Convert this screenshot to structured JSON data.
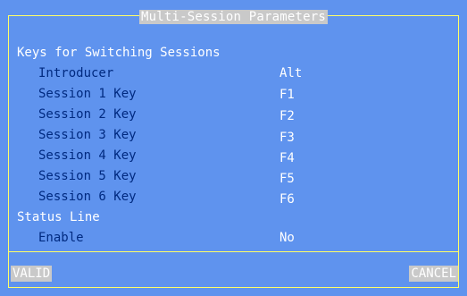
{
  "dialog": {
    "title": "Multi-Session Parameters",
    "sections": [
      {
        "heading": "Keys for Switching Sessions",
        "rows": [
          {
            "label": "Introducer",
            "value": "Alt"
          },
          {
            "label": "Session 1 Key",
            "value": "F1"
          },
          {
            "label": "Session 2 Key",
            "value": "F2"
          },
          {
            "label": "Session 3 Key",
            "value": "F3"
          },
          {
            "label": "Session 4 Key",
            "value": "F4"
          },
          {
            "label": "Session 5 Key",
            "value": "F5"
          },
          {
            "label": "Session 6 Key",
            "value": "F6"
          }
        ]
      },
      {
        "heading": "Status Line",
        "rows": [
          {
            "label": "Enable",
            "value": "No"
          }
        ]
      }
    ],
    "buttons": {
      "valid": "VALID",
      "cancel": "CANCEL"
    }
  },
  "colors": {
    "background": "#5f93ee",
    "frame": "#ffff66",
    "heading_text": "#ffffff",
    "label_text": "#002a80",
    "value_text": "#ffffff",
    "button_bg": "#c9c9c9"
  }
}
